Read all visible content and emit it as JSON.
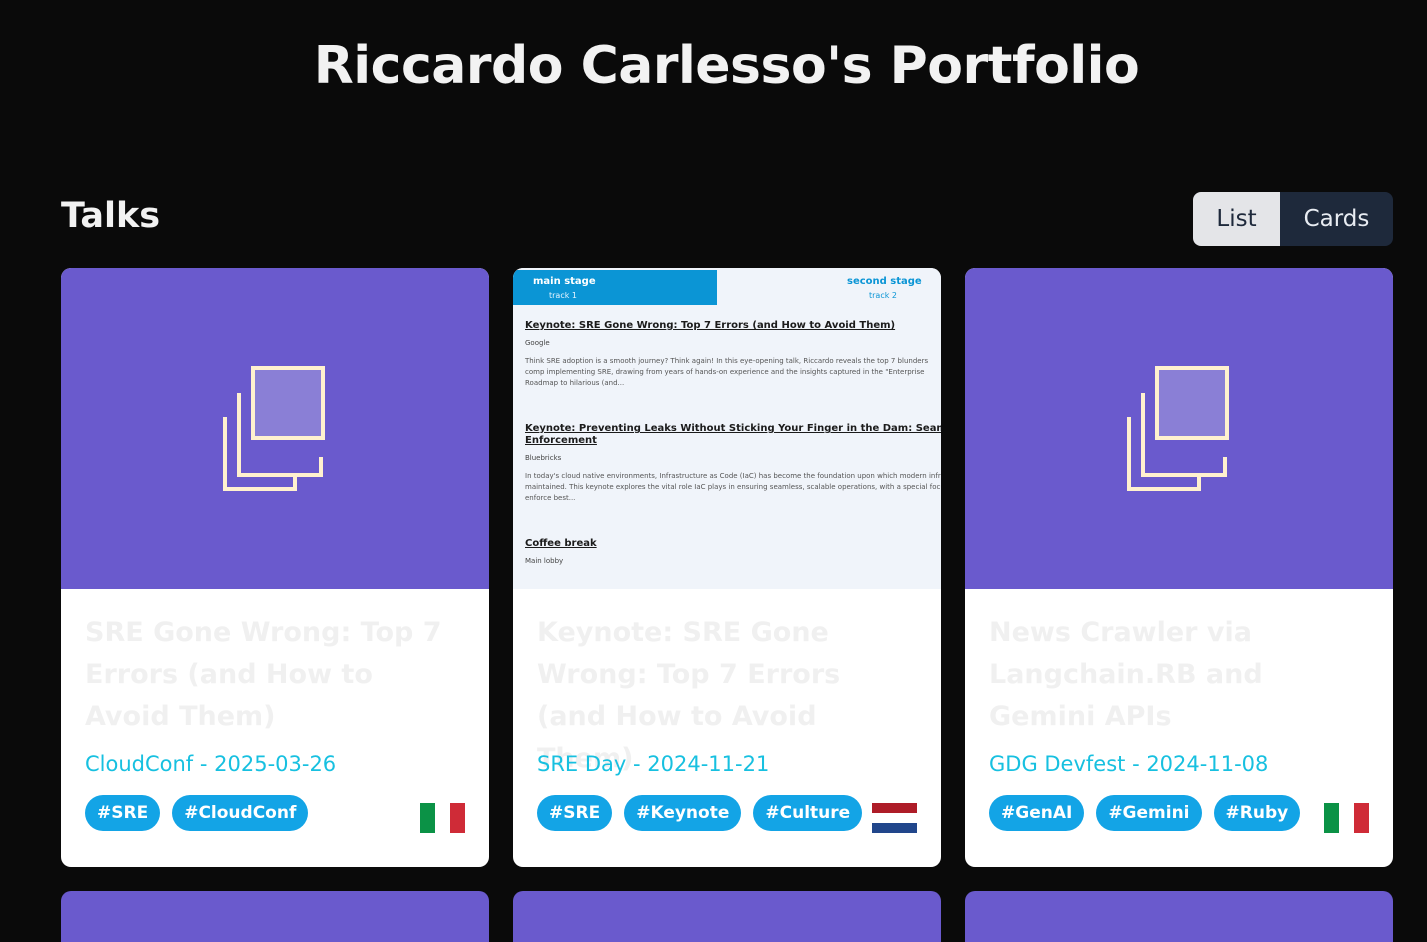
{
  "site": {
    "title": "Riccardo Carlesso's Portfolio"
  },
  "section": {
    "title": "Talks"
  },
  "view_toggle": {
    "list_label": "List",
    "cards_label": "Cards"
  },
  "colors": {
    "image_bg": "#6a5acd",
    "accent": "#17c0e0",
    "tag": "#13a4e6"
  },
  "cards": [
    {
      "title": "SRE Gone Wrong: Top 7 Errors (and How to Avoid Them)",
      "subtitle": "CloudConf - 2025-03-26",
      "tags": [
        "#SRE",
        "#CloudConf"
      ],
      "flag": "italy-flag-icon",
      "image": "placeholder-image-icon"
    },
    {
      "title": "Keynote: SRE Gone Wrong: Top 7 Errors (and How to Avoid Them)",
      "subtitle": "SRE Day - 2024-11-21",
      "tags": [
        "#SRE",
        "#Keynote",
        "#Culture"
      ],
      "flag": "netherlands-flag-icon",
      "schedule": {
        "tab_main": "main stage",
        "tab_main_sub": "track 1",
        "tab_second": "second stage",
        "tab_second_sub": "track 2",
        "entries": [
          {
            "title": "Keynote: SRE Gone Wrong: Top 7 Errors (and How to Avoid Them)",
            "org": "Google",
            "desc": "Think SRE adoption is a smooth journey? Think again! In this eye-opening talk, Riccardo reveals the top 7 blunders comp implementing SRE, drawing from years of hands-on experience and the insights captured in the \"Enterprise Roadmap to hilarious (and..."
          },
          {
            "title": "Keynote: Preventing Leaks Without Sticking Your Finger in the Dam: Seamless Ia",
            "title2": "Enforcement",
            "org": "Bluebricks",
            "desc": "In today's cloud native environments, Infrastructure as Code (IaC) has become the foundation upon which modern infra maintained. This keynote explores the vital role IaC plays in ensuring seamless, scalable operations, with a special focu enforce best..."
          },
          {
            "title": "Coffee break",
            "org": "Main lobby"
          }
        ]
      }
    },
    {
      "title": "News Crawler via Langchain.RB and Gemini APIs",
      "subtitle": "GDG Devfest - 2024-11-08",
      "tags": [
        "#GenAI",
        "#Gemini",
        "#Ruby"
      ],
      "flag": "italy-flag-icon",
      "image": "placeholder-image-icon"
    }
  ]
}
